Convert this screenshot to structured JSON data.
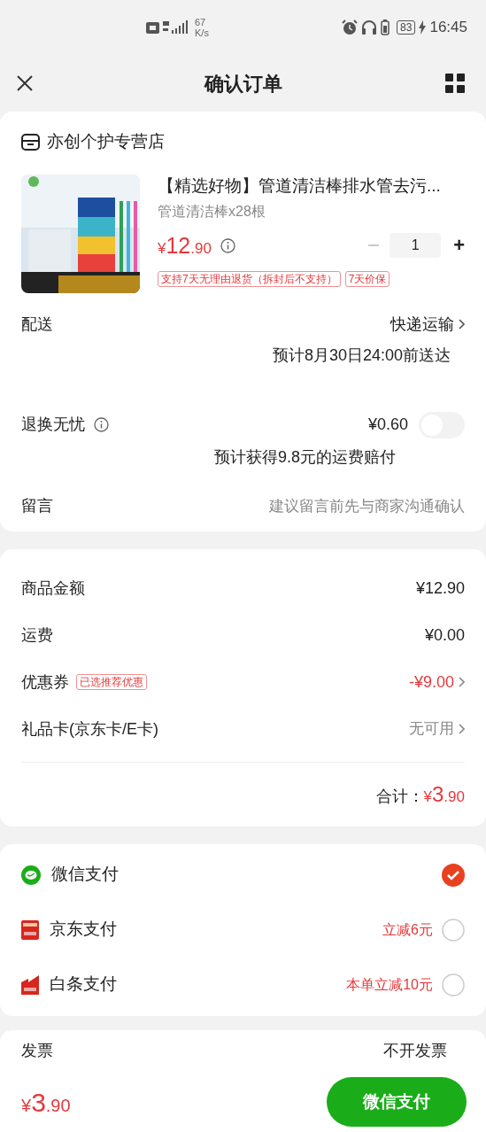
{
  "status_bar": {
    "speed": "67",
    "speed_unit": "K/s",
    "battery": "83",
    "time": "16:45"
  },
  "header": {
    "title": "确认订单"
  },
  "store": {
    "name": "亦创个护专营店"
  },
  "product": {
    "image": {
      "kind": "picture"
    },
    "title": "【精选好物】管道清洁棒排水管去污...",
    "spec": "管道清洁棒x28根",
    "price": {
      "currency": "¥",
      "integer": "12",
      "decimal": ".90"
    },
    "quantity": "1",
    "plus": "+",
    "tags": [
      "支持7天无理由退货（拆封后不支持）",
      "7天价保"
    ]
  },
  "delivery": {
    "label": "配送",
    "method": "快递运输",
    "estimate": "预计8月30日24:00前送达"
  },
  "return_insurance": {
    "label": "退换无忧",
    "price": "¥0.60",
    "on": false,
    "note": "预计获得9.8元的运费赔付"
  },
  "message": {
    "label": "留言",
    "placeholder": "建议留言前先与商家沟通确认"
  },
  "fees": [
    {
      "kind": "plain",
      "label": "商品金额",
      "value": "¥12.90"
    },
    {
      "kind": "plain",
      "label": "运费",
      "value": "¥0.00"
    },
    {
      "kind": "discount",
      "label": "优惠券",
      "tag": "已选推荐优惠",
      "value": "-¥9.00"
    },
    {
      "kind": "option",
      "label": "礼品卡(京东卡/E卡)",
      "value": "无可用"
    }
  ],
  "total": {
    "label": "合计：",
    "currency": "¥",
    "integer": "3",
    "decimal": ".90"
  },
  "payments": [
    {
      "kind": "wechat",
      "label": "微信支付",
      "selected": true
    },
    {
      "kind": "jd",
      "label": "京东支付",
      "promo": "立减6元",
      "selected": false
    },
    {
      "kind": "baitiao",
      "label": "白条支付",
      "promo": "本单立减10元",
      "selected": false
    }
  ],
  "invoice": {
    "label": "发票",
    "value": "不开发票"
  },
  "bottom_bar": {
    "currency": "¥",
    "integer": "3",
    "decimal": ".90",
    "pay_button": "微信支付"
  }
}
